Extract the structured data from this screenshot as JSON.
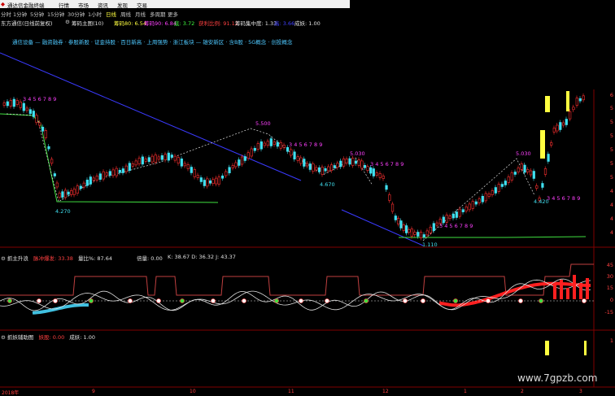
{
  "titlebar": {
    "title": "通达信金融终端",
    "menus": [
      "行情",
      "市场",
      "资讯",
      "发现",
      "交易"
    ]
  },
  "tabs": [
    "分时",
    "1分钟",
    "5分钟",
    "15分钟",
    "30分钟",
    "1小时",
    "日线",
    "周线",
    "月线",
    "多周期",
    "更多"
  ],
  "active_tab": "日线",
  "stock": {
    "name": "东方通信(日线前复权)",
    "indicator": "筹码主图(10)",
    "chip80_label": "筹码80: 6.54",
    "chip90_label": "筹码90: 6.84",
    "low_label": "底: 3.72",
    "profit_label": "获利比例: 91.12",
    "concentration_label": "筹码集中度: 1.33",
    "high_label": "高: 3.66",
    "success_label": "成妖: 1.00"
  },
  "concepts": "通信设备 — 融资融券 · 参股新股 · 证金持股 · 百日新高 · 上周强势 · 浙江板块 — 雄安新区 · 含B股 · 5G概念 · 创投概念",
  "price_axis": [
    "6",
    "5",
    "5",
    "5",
    "5",
    "5",
    "5",
    "4",
    "4",
    "4",
    "4"
  ],
  "annotations": {
    "high1": "5.500",
    "high2": "5.030",
    "high3": "5.030",
    "low1": "4.270",
    "low2": "4.670",
    "low3": "4.420",
    "low4": "1.110",
    "seq": "3 4 5 6 7 8 9"
  },
  "panel1": {
    "name": "抓主升浪",
    "signal": "脉冲爆发: 33.38",
    "vol_ratio": "量比%: 87.64",
    "volume": "倍量: 0.00",
    "kdj": "K: 38.67  D: 36.32  J: 43.37",
    "axis": [
      "45",
      "30",
      "15",
      "0",
      "-15"
    ]
  },
  "panel2": {
    "name": "抓妖辅助图",
    "demon": "妖股: 0.00",
    "success": "成妖: 1.00",
    "axis": [
      "1"
    ]
  },
  "x_axis": [
    "2018年",
    "9",
    "10",
    "11",
    "12",
    "1",
    "2",
    "3"
  ],
  "watermark": "www.7gpzb.com",
  "colors": {
    "up": "#ff3030",
    "down": "#40e0f0",
    "support": "#40e040",
    "trend": "#4040ff",
    "demon": "#ffff40"
  }
}
